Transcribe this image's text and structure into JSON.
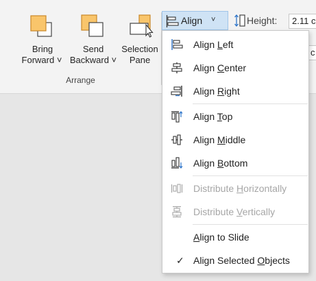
{
  "ribbon": {
    "bring_forward": {
      "line1": "Bring",
      "line2": "Forward ˅"
    },
    "send_backward": {
      "line1": "Send",
      "line2": "Backward ˅"
    },
    "selection_pane": {
      "line1": "Selection",
      "line2": "Pane"
    },
    "group_label": "Arrange",
    "align_button": {
      "label": "Align",
      "chevron": "˅"
    },
    "height": {
      "label": "Height:",
      "value": "2.11 c"
    },
    "width": {
      "value": "c"
    }
  },
  "menu": {
    "items": [
      {
        "pre": "Align ",
        "ul": "L",
        "post": "eft",
        "icon": "align-left-icon",
        "enabled": true
      },
      {
        "pre": "Align ",
        "ul": "C",
        "post": "enter",
        "icon": "align-center-icon",
        "enabled": true
      },
      {
        "pre": "Align ",
        "ul": "R",
        "post": "ight",
        "icon": "align-right-icon",
        "enabled": true
      },
      {
        "pre": "Align ",
        "ul": "T",
        "post": "op",
        "icon": "align-top-icon",
        "enabled": true
      },
      {
        "pre": "Align ",
        "ul": "M",
        "post": "iddle",
        "icon": "align-middle-icon",
        "enabled": true
      },
      {
        "pre": "Align ",
        "ul": "B",
        "post": "ottom",
        "icon": "align-bottom-icon",
        "enabled": true
      },
      {
        "pre": "Distribute ",
        "ul": "H",
        "post": "orizontally",
        "icon": "distribute-horizontally-icon",
        "enabled": false
      },
      {
        "pre": "Distribute ",
        "ul": "V",
        "post": "ertically",
        "icon": "distribute-vertically-icon",
        "enabled": false
      },
      {
        "pre": "",
        "ul": "A",
        "post": "lign to Slide",
        "icon": "",
        "enabled": true,
        "checked": false
      },
      {
        "pre": "Align Selected ",
        "ul": "O",
        "post": "bjects",
        "icon": "checkmark-icon",
        "enabled": true,
        "checked": true
      }
    ],
    "checkmark": "✓"
  },
  "colors": {
    "accent_blue": "#2e75c9",
    "highlight": "#cfe3f5",
    "shape_orange": "#f9c56b"
  }
}
